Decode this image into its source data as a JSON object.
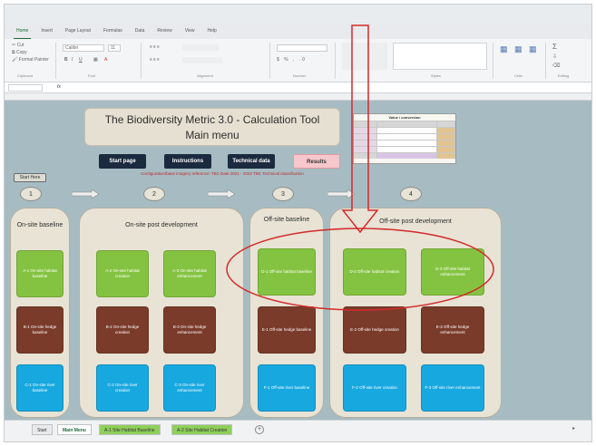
{
  "ribbon": {
    "tabs": [
      "Home",
      "Insert",
      "Page Layout",
      "Formulas",
      "Data",
      "Review",
      "View",
      "Help"
    ],
    "clipboard_items": [
      "Cut",
      "Copy",
      "Format Painter"
    ],
    "font_name": "Calibri",
    "font_size": "11",
    "group_labels": [
      "Clipboard",
      "Font",
      "Alignment",
      "Number",
      "Styles",
      "Cells",
      "Editing"
    ]
  },
  "formula_bar": {
    "cell_ref": "",
    "fx": "fx"
  },
  "sheet": {
    "title_line1": "The Biodiversity Metric 3.0 - Calculation Tool",
    "title_line2": "Main menu",
    "nav_buttons": [
      "Start page",
      "Instructions",
      "Technical data",
      "Results"
    ],
    "disclaimer": "Configuration/base imagery reference: TBC Date 2021 - 2022 TBC Technical classification",
    "conversions_title": "Value / conversion",
    "start_here": "Start Here",
    "steps": [
      "1",
      "2",
      "3",
      "4"
    ],
    "panels": {
      "on_site_baseline": {
        "title": "On-site baseline",
        "cards": [
          "A-1 On-site habitat baseline",
          "B-1 On-site hedge baseline",
          "C-1 On-site river baseline"
        ]
      },
      "on_site_post_development": {
        "title": "On-site post development",
        "cards": [
          "A-2 On-site habitat creation",
          "A-3 On-site habitat enhancement",
          "B-2 On-site hedge creation",
          "B-3 On-site hedge enhancement",
          "C-2 On-site river creation",
          "C-3 On-site river enhancement"
        ]
      },
      "off_site_baseline": {
        "title": "Off-site baseline",
        "cards": [
          "D-1 Off-site habitat baseline",
          "E-1 Off-site hedge baseline",
          "F-1 Off-site river baseline"
        ]
      },
      "off_site_post_development": {
        "title": "Off-site post development",
        "cards": [
          "D-2 Off-site habitat creation",
          "D-3 Off-site habitat enhancement",
          "E-2 Off-site hedge creation",
          "E-3 Off-site hedge enhancement",
          "F-2 Off-site river creation",
          "F-3 Off-site river enhancement"
        ]
      }
    }
  },
  "sheet_tabs": [
    "Start",
    "Main Menu",
    "A-1 Site Habitat Baseline",
    "A-2 Site Habitat Creation"
  ],
  "colors": {
    "sheet_bg": "#a6bcc2",
    "habitat": "#84c341",
    "hedge": "#7a3b2b",
    "river": "#18a8e0",
    "annotation": "#d42a2a",
    "nav_dark": "#1b2a3f"
  }
}
